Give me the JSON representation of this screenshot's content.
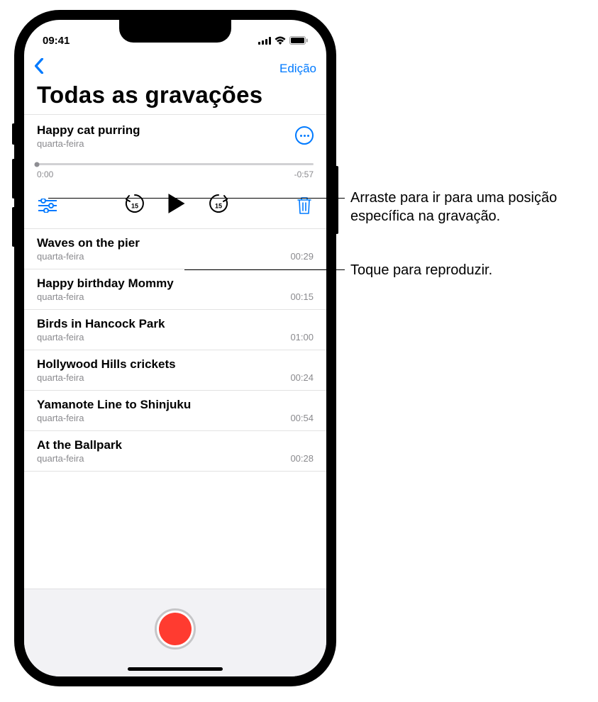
{
  "status": {
    "time": "09:41"
  },
  "nav": {
    "edit": "Edição"
  },
  "page_title": "Todas as gravações",
  "expanded": {
    "title": "Happy cat purring",
    "date": "quarta-feira",
    "elapsed": "0:00",
    "remaining": "-0:57",
    "skip_amount": "15"
  },
  "recordings": [
    {
      "title": "Waves on the pier",
      "date": "quarta-feira",
      "duration": "00:29"
    },
    {
      "title": "Happy birthday Mommy",
      "date": "quarta-feira",
      "duration": "00:15"
    },
    {
      "title": "Birds in Hancock Park",
      "date": "quarta-feira",
      "duration": "01:00"
    },
    {
      "title": "Hollywood Hills crickets",
      "date": "quarta-feira",
      "duration": "00:24"
    },
    {
      "title": "Yamanote Line to Shinjuku",
      "date": "quarta-feira",
      "duration": "00:54"
    },
    {
      "title": "At the Ballpark",
      "date": "quarta-feira",
      "duration": "00:28"
    }
  ],
  "callouts": {
    "scrub": "Arraste para ir para uma posição específica na gravação.",
    "play": "Toque para reproduzir."
  }
}
